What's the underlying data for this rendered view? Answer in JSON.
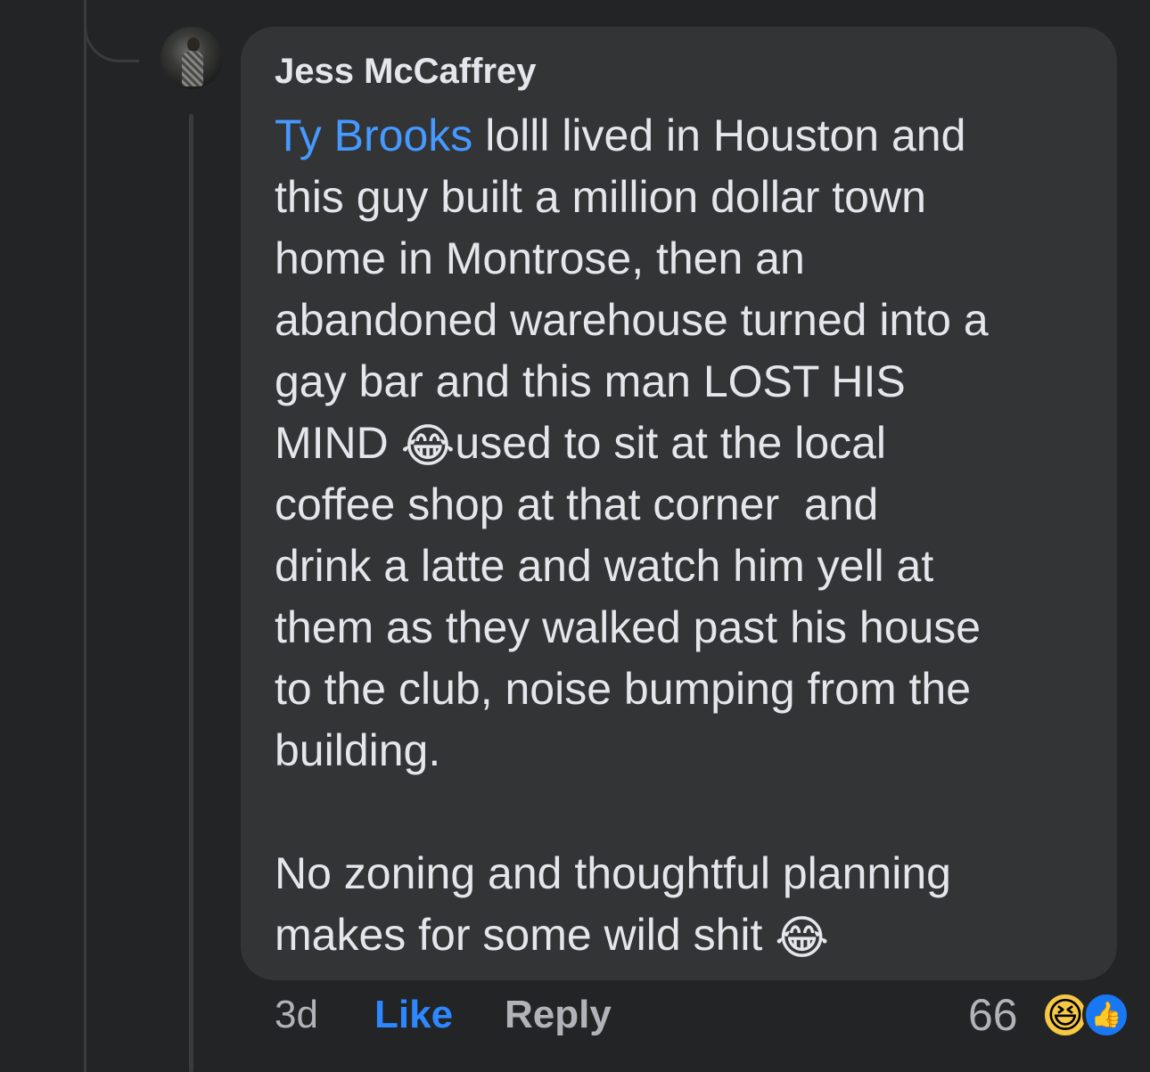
{
  "comment": {
    "author": "Jess McCaffrey",
    "mention": "Ty Brooks",
    "lines": [
      " lolll lived in Houston and",
      "this guy built a million dollar town",
      "home in Montrose, then an",
      "abandoned warehouse turned into a",
      "gay bar and this man LOST HIS",
      "MIND ",
      "used to sit at the local",
      "coffee shop at that corner  and",
      "drink a latte and watch him yell at",
      "them as they walked past his house",
      "to the club, noise bumping from the",
      "building.",
      "No zoning and thoughtful planning",
      "makes for some wild shit "
    ],
    "emoji_laugh": "😂"
  },
  "actions": {
    "time": "3d",
    "like_label": "Like",
    "reply_label": "Reply"
  },
  "reactions": {
    "count": "66",
    "haha_icon": "haha-reaction-icon",
    "like_icon": "like-reaction-icon",
    "haha_glyph": "😆",
    "like_glyph": "👍"
  },
  "colors": {
    "background": "#232426",
    "bubble": "#333436",
    "text": "#e4e6eb",
    "mention": "#4599ff",
    "like_action": "#2d88ff",
    "muted": "#b0b3b8"
  }
}
